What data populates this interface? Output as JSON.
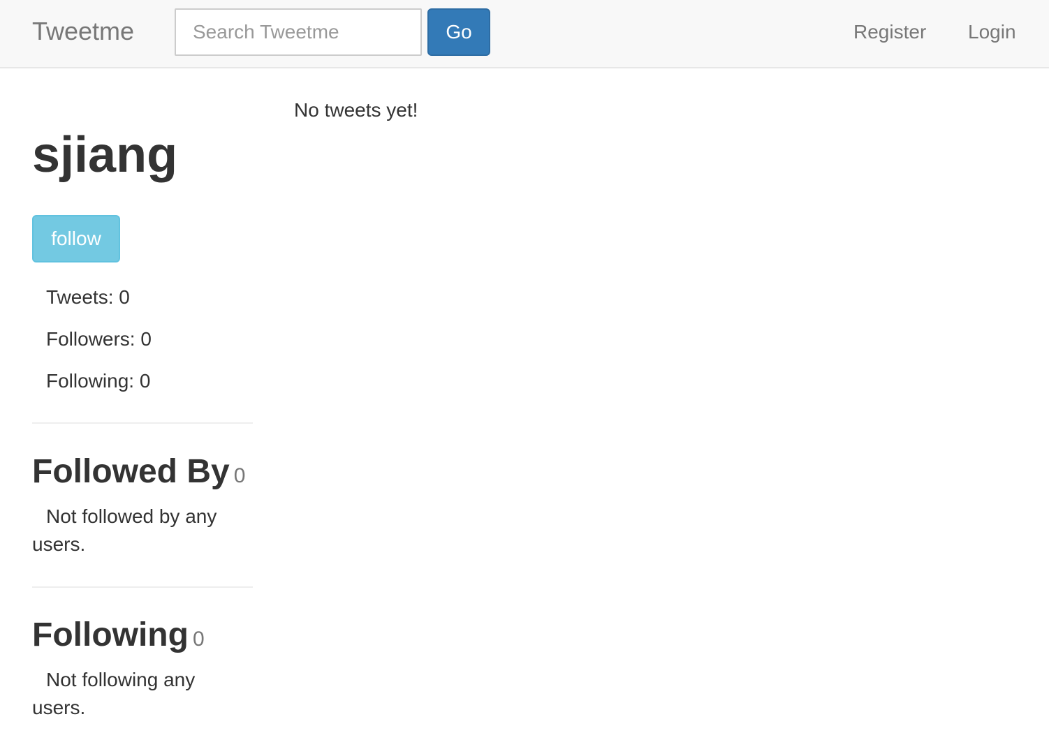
{
  "navbar": {
    "brand": "Tweetme",
    "search_placeholder": "Search Tweetme",
    "go_label": "Go",
    "register_label": "Register",
    "login_label": "Login"
  },
  "profile": {
    "username": "sjiang",
    "follow_label": "follow",
    "tweets_stat": "Tweets: 0",
    "followers_stat": "Followers: 0",
    "following_stat": "Following: 0"
  },
  "followed_by": {
    "heading": "Followed By",
    "count": "0",
    "empty_text": "Not followed by any users."
  },
  "following": {
    "heading": "Following",
    "count": "0",
    "empty_text": "Not following any users."
  },
  "main": {
    "empty_message": "No tweets yet!"
  },
  "colors": {
    "navbar_bg": "#f8f8f8",
    "primary": "#337ab7",
    "info": "#5bc0de",
    "text": "#333333",
    "muted": "#777777"
  }
}
